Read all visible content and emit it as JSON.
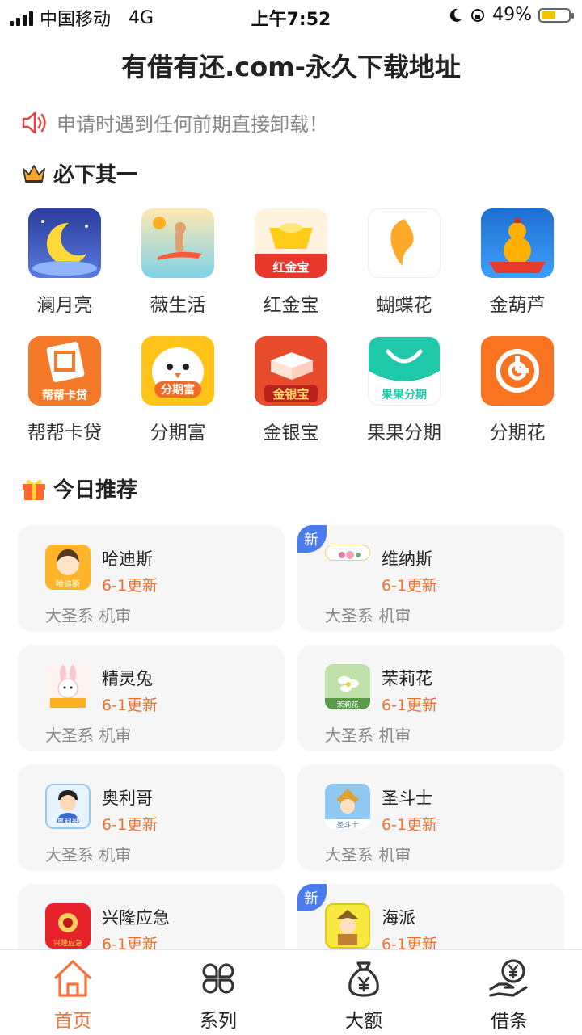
{
  "status_bar": {
    "carrier": "中国移动",
    "network": "4G",
    "time": "上午7:52",
    "battery": "49%"
  },
  "page_title": "有借有还.com-永久下载地址",
  "notice": "申请时遇到任何前期直接卸载！",
  "must_section": {
    "title": "必下其一"
  },
  "apps": [
    {
      "label": "澜月亮",
      "icon_text": ""
    },
    {
      "label": "薇生活",
      "icon_text": ""
    },
    {
      "label": "红金宝",
      "icon_text": "红金宝"
    },
    {
      "label": "蝴蝶花",
      "icon_text": ""
    },
    {
      "label": "金葫芦",
      "icon_text": ""
    },
    {
      "label": "帮帮卡贷",
      "icon_text": "帮帮卡贷"
    },
    {
      "label": "分期富",
      "icon_text": "分期富"
    },
    {
      "label": "金银宝",
      "icon_text": "金银宝"
    },
    {
      "label": "果果分期",
      "icon_text": "果果分期"
    },
    {
      "label": "分期花",
      "icon_text": ""
    }
  ],
  "today_section": {
    "title": "今日推荐"
  },
  "recommend": [
    {
      "name": "哈迪斯",
      "update": "6-1更新",
      "tags": "大圣系 机审",
      "badge": "",
      "icon_text": "哈迪斯"
    },
    {
      "name": "维纳斯",
      "update": "6-1更新",
      "tags": "大圣系 机审",
      "badge": "新",
      "icon_text": ""
    },
    {
      "name": "精灵兔",
      "update": "6-1更新",
      "tags": "大圣系 机审",
      "badge": "",
      "icon_text": ""
    },
    {
      "name": "茉莉花",
      "update": "6-1更新",
      "tags": "大圣系 机审",
      "badge": "",
      "icon_text": "茉莉花"
    },
    {
      "name": "奥利哥",
      "update": "6-1更新",
      "tags": "大圣系 机审",
      "badge": "",
      "icon_text": "奥利哥"
    },
    {
      "name": "圣斗士",
      "update": "6-1更新",
      "tags": "大圣系 机审",
      "badge": "",
      "icon_text": "圣斗士"
    },
    {
      "name": "兴隆应急",
      "update": "6-1更新",
      "tags": "",
      "badge": "",
      "icon_text": "兴隆应急"
    },
    {
      "name": "海派",
      "update": "6-1更新",
      "tags": "",
      "badge": "新",
      "icon_text": ""
    }
  ],
  "tabs": [
    {
      "label": "首页",
      "icon": "home-icon",
      "active": true
    },
    {
      "label": "系列",
      "icon": "grid-icon",
      "active": false
    },
    {
      "label": "大额",
      "icon": "money-bag-icon",
      "active": false
    },
    {
      "label": "借条",
      "icon": "hand-yen-icon",
      "active": false
    }
  ],
  "colors": {
    "accent": "#f5733a",
    "update_text": "#f0712e",
    "badge": "#4a7cf0",
    "card_bg": "#f6f6f7"
  }
}
